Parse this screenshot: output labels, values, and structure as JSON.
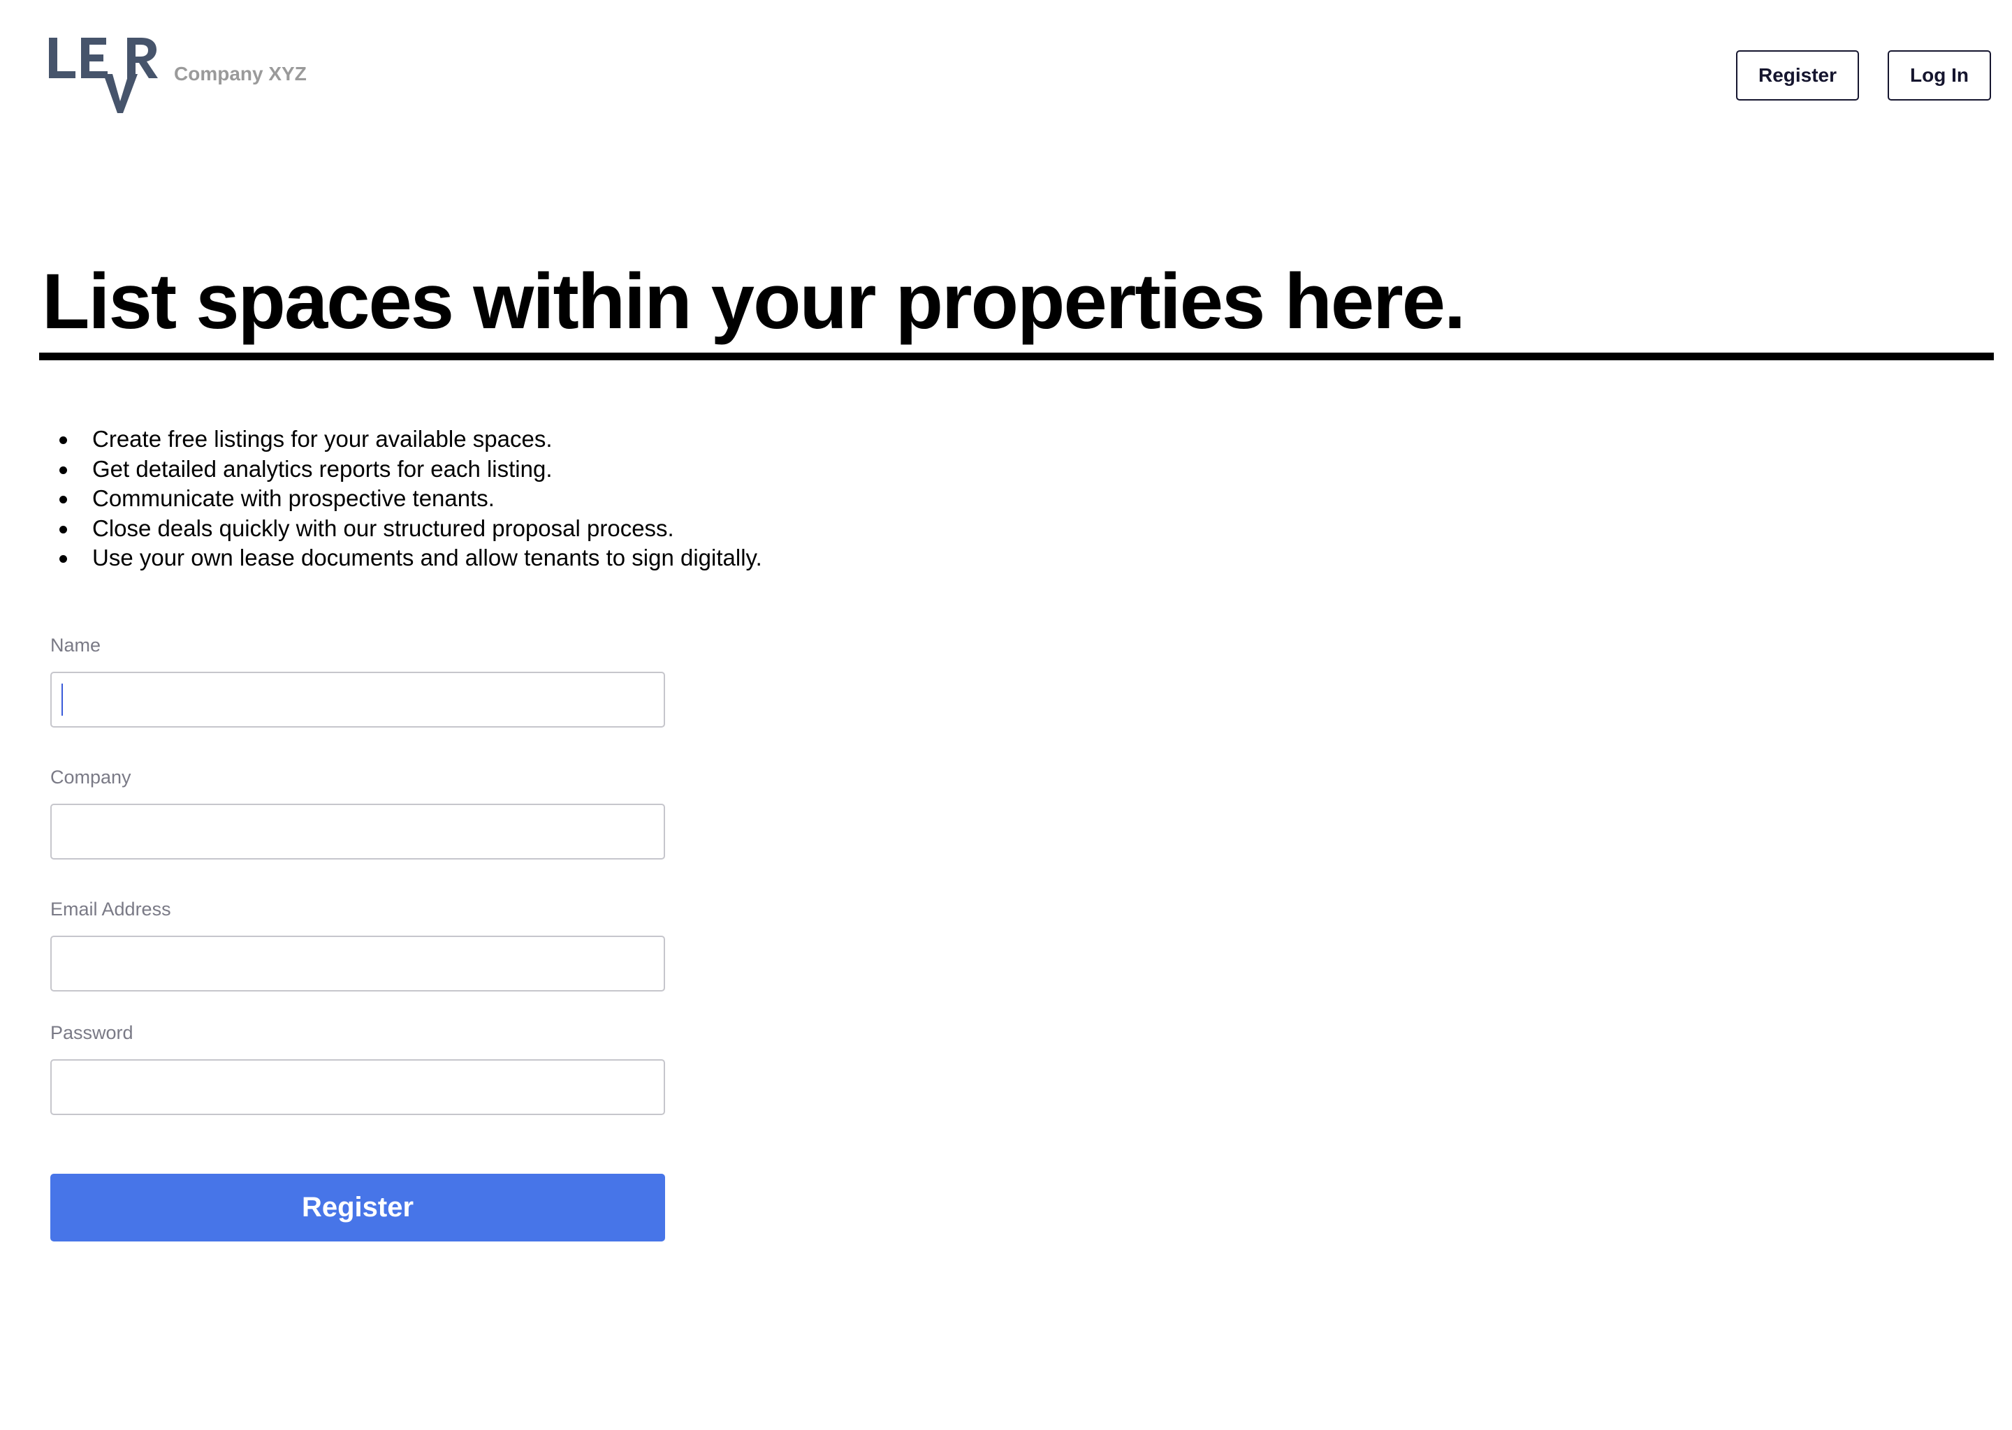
{
  "header": {
    "logo": {
      "name": "LEVR",
      "color": "#46546b"
    },
    "company_name": "Company XYZ",
    "register_label": "Register",
    "login_label": "Log In"
  },
  "hero": {
    "title": "List spaces within your properties here."
  },
  "features": [
    "Create free listings for your available spaces.",
    "Get detailed analytics reports for each listing.",
    "Communicate with prospective tenants.",
    "Close deals quickly with our structured proposal process.",
    "Use your own lease documents and allow tenants to sign digitally."
  ],
  "form": {
    "name_label": "Name",
    "name_value": "",
    "company_label": "Company",
    "company_value": "",
    "email_label": "Email Address",
    "email_value": "",
    "password_label": "Password",
    "password_value": "",
    "submit_label": "Register",
    "submit_color": "#4775e8"
  }
}
